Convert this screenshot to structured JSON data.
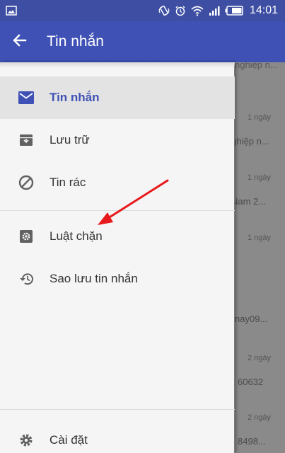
{
  "status_bar": {
    "time": "14:01",
    "icons": [
      "image-icon",
      "vibrate-icon",
      "alarm-icon",
      "wifi-icon",
      "signal-icon",
      "battery-icon"
    ]
  },
  "toolbar": {
    "title": "Tin nhắn",
    "back_icon": "back-arrow-icon",
    "color": "#3f51b5"
  },
  "drawer": {
    "items": [
      {
        "label": "Tin nhắn",
        "icon": "mail-icon",
        "active": true
      },
      {
        "label": "Lưu trữ",
        "icon": "archive-icon",
        "active": false
      },
      {
        "label": "Tin rác",
        "icon": "block-icon",
        "active": false
      },
      {
        "label": "Luật chặn",
        "icon": "settings-box-icon",
        "active": false
      },
      {
        "label": "Sao lưu tin nhắn",
        "icon": "restore-icon",
        "active": false
      },
      {
        "label": "Cài đặt",
        "icon": "gear-icon",
        "active": false
      }
    ]
  },
  "background_messages": [
    {
      "date": "1 ngày",
      "snippet": "nghiệp n..."
    },
    {
      "date": "1 ngày",
      "snippet": "Nam 2..."
    },
    {
      "date": "1 ngày",
      "snippet": ""
    },
    {
      "date": "1 ngày",
      "snippet": "nay09..."
    },
    {
      "date": "2 ngày",
      "snippet": "60632"
    },
    {
      "date": "2 ngày",
      "snippet": "8498..."
    }
  ],
  "annotation": {
    "type": "arrow",
    "color": "#e8191b"
  }
}
